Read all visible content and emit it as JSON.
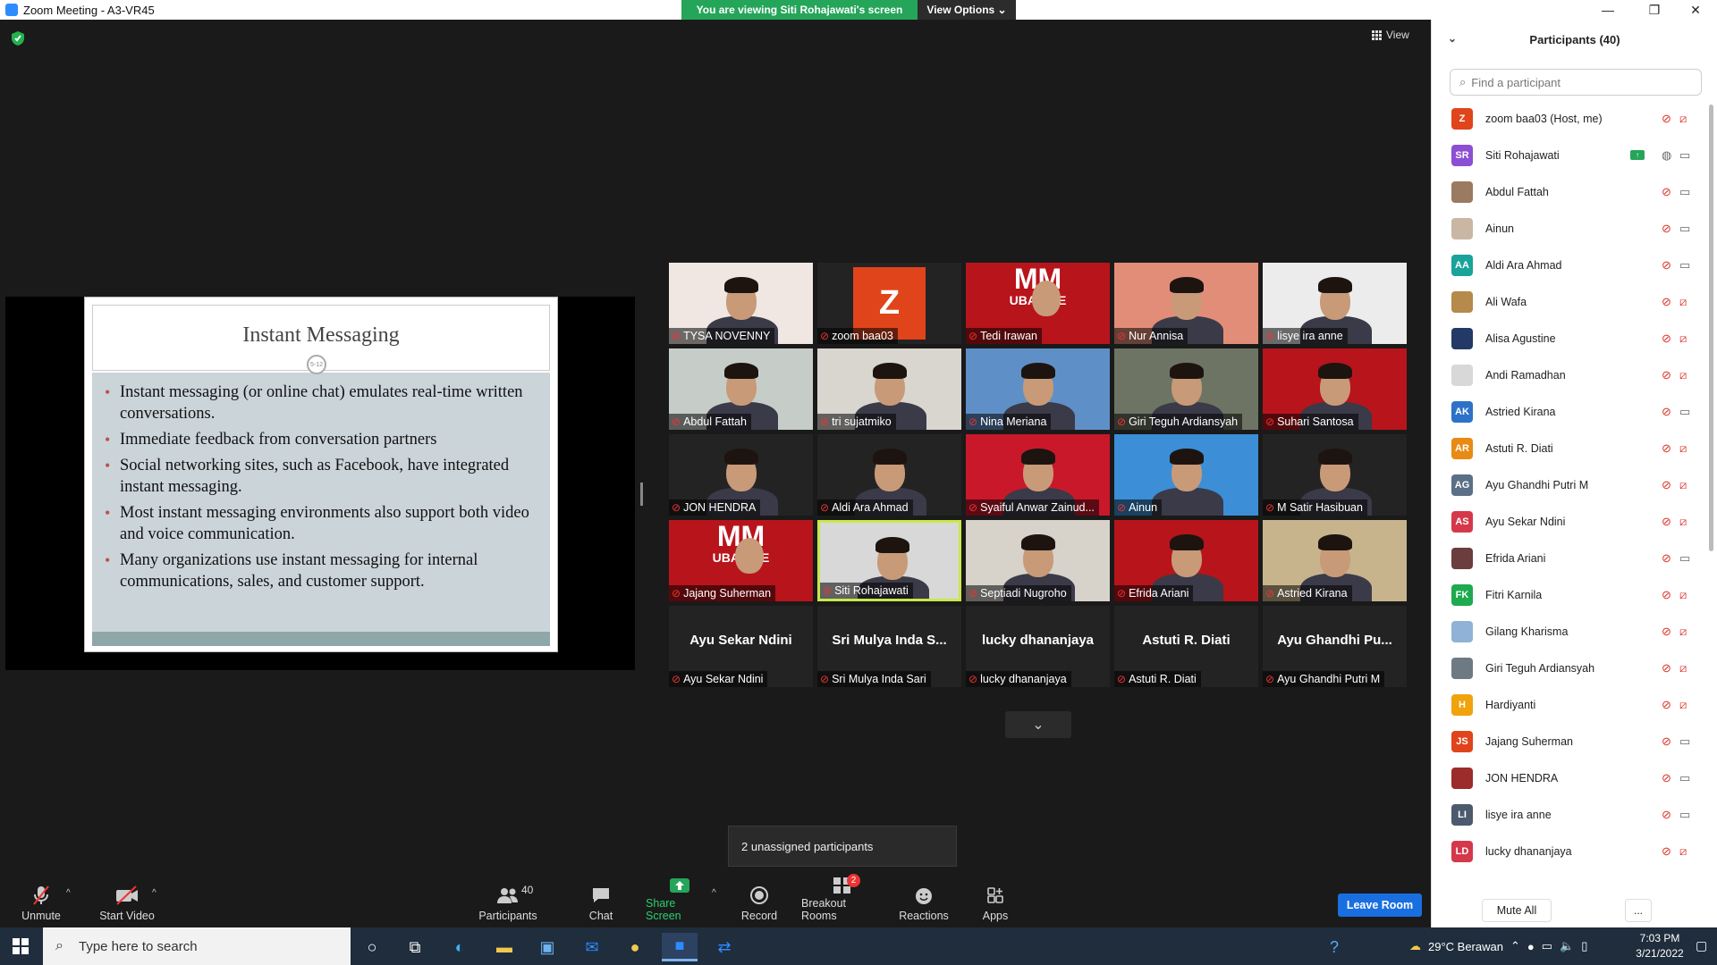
{
  "window": {
    "title": "Zoom Meeting - A3-VR45",
    "controls": [
      "—",
      "❐",
      "✕"
    ]
  },
  "share_banner": {
    "text": "You are viewing Siti Rohajawati's screen",
    "options_label": "View Options ⌄"
  },
  "view_button": {
    "label": "View"
  },
  "slide": {
    "title": "Instant Messaging",
    "number": "5-12",
    "bullets": [
      "Instant messaging (or online chat) emulates real-time written conversations.",
      "Immediate feedback from conversation partners",
      "Social networking sites, such as Facebook,  have integrated instant messaging.",
      "Most instant messaging environments also support both video and voice communication.",
      "Many organizations use instant messaging for internal communications, sales, and customer support."
    ]
  },
  "video_tiles": [
    {
      "name": "TYSA NOVENNY",
      "bg": "#f0e6e2"
    },
    {
      "name": "zoom baa03",
      "bg": "#232323",
      "avatar": "Z"
    },
    {
      "name": "Tedi Irawan",
      "bg": "#b8141c",
      "overlay": "MM"
    },
    {
      "name": "Nur Annisa",
      "bg": "#e28d78"
    },
    {
      "name": "lisye ira anne",
      "bg": "#ececec"
    },
    {
      "name": "Abdul Fattah",
      "bg": "#c6cdc8"
    },
    {
      "name": "tri sujatmiko",
      "bg": "#d9d6d0"
    },
    {
      "name": "Nina Meriana",
      "bg": "#5f8fc7"
    },
    {
      "name": "Giri Teguh Ardiansyah",
      "bg": "#6d7463"
    },
    {
      "name": "Suhari Santosa",
      "bg": "#b8141c"
    },
    {
      "name": "JON HENDRA",
      "bg": "#232323"
    },
    {
      "name": "Aldi Ara Ahmad",
      "bg": "#232323"
    },
    {
      "name": "Syaiful Anwar Zainud...",
      "bg": "#c9182a"
    },
    {
      "name": "Ainun",
      "bg": "#3c8ed6"
    },
    {
      "name": "M Satir Hasibuan",
      "bg": "#232323"
    },
    {
      "name": "Jajang Suherman",
      "bg": "#b8141c",
      "overlay": "MM"
    },
    {
      "name": "Siti Rohajawati",
      "bg": "#d8d8d8",
      "active": true
    },
    {
      "name": "Septiadi Nugroho",
      "bg": "#d7d2ca"
    },
    {
      "name": "Efrida Ariani",
      "bg": "#b8141c"
    },
    {
      "name": "Astried Kirana",
      "bg": "#c7b48d"
    },
    {
      "name": "Ayu Sekar Ndini",
      "bg": "#232323",
      "big": "Ayu Sekar Ndini"
    },
    {
      "name": "Sri Mulya Inda Sari",
      "bg": "#232323",
      "big": "Sri Mulya Inda S..."
    },
    {
      "name": "lucky dhananjaya",
      "bg": "#232323",
      "big": "lucky dhananjaya"
    },
    {
      "name": "Astuti R. Diati",
      "bg": "#232323",
      "big": "Astuti R. Diati"
    },
    {
      "name": "Ayu Ghandhi Putri M",
      "bg": "#232323",
      "big": "Ayu Ghandhi Pu..."
    }
  ],
  "tile_overlay_sub": "UBAKRIE",
  "unassigned": "2 unassigned participants",
  "toolbar": {
    "unmute": "Unmute",
    "start_video": "Start Video",
    "participants": "Participants",
    "participants_count": "40",
    "chat": "Chat",
    "share_screen": "Share Screen",
    "record": "Record",
    "breakout_rooms": "Breakout Rooms",
    "breakout_badge": "2",
    "reactions": "Reactions",
    "apps": "Apps",
    "leave_room": "Leave Room"
  },
  "panel": {
    "title": "Participants (40)",
    "search_placeholder": "Find a participant",
    "mute_all": "Mute All",
    "more": "...",
    "participants": [
      {
        "name": "zoom baa03 (Host, me)",
        "initials": "Z",
        "color": "#e0441b",
        "cam_on": false
      },
      {
        "name": "Siti Rohajawati",
        "initials": "SR",
        "color": "#8c4fd3",
        "cam_on": true,
        "sharing": true
      },
      {
        "name": "Abdul Fattah",
        "initials": "",
        "color": "#9b7a62",
        "cam_on": true
      },
      {
        "name": "Ainun",
        "initials": "",
        "color": "#c9b7a3",
        "cam_on": true
      },
      {
        "name": "Aldi Ara Ahmad",
        "initials": "AA",
        "color": "#1aa39a",
        "cam_on": true
      },
      {
        "name": "Ali Wafa",
        "initials": "",
        "color": "#b58a4a",
        "cam_on": false
      },
      {
        "name": "Alisa Agustine",
        "initials": "",
        "color": "#233a66",
        "cam_on": false
      },
      {
        "name": "Andi Ramadhan",
        "initials": "",
        "color": "#d8d8d8",
        "cam_on": false
      },
      {
        "name": "Astried Kirana",
        "initials": "AK",
        "color": "#2d72c8",
        "cam_on": true
      },
      {
        "name": "Astuti R. Diati",
        "initials": "AR",
        "color": "#e88a13",
        "cam_on": false
      },
      {
        "name": "Ayu Ghandhi Putri M",
        "initials": "AG",
        "color": "#5b6f86",
        "cam_on": false
      },
      {
        "name": "Ayu Sekar Ndini",
        "initials": "AS",
        "color": "#d5384a",
        "cam_on": false
      },
      {
        "name": "Efrida Ariani",
        "initials": "",
        "color": "#6b3d3d",
        "cam_on": true
      },
      {
        "name": "Fitri Karnila",
        "initials": "FK",
        "color": "#1eaa4e",
        "cam_on": false
      },
      {
        "name": "Gilang Kharisma",
        "initials": "",
        "color": "#8fb2d6",
        "cam_on": false
      },
      {
        "name": "Giri Teguh Ardiansyah",
        "initials": "",
        "color": "#6e7a83",
        "cam_on": false
      },
      {
        "name": "Hardiyanti",
        "initials": "H",
        "color": "#f0a30c",
        "cam_on": false
      },
      {
        "name": "Jajang Suherman",
        "initials": "JS",
        "color": "#e0441b",
        "cam_on": true
      },
      {
        "name": "JON HENDRA",
        "initials": "",
        "color": "#9c2b2b",
        "cam_on": true
      },
      {
        "name": "lisye ira anne",
        "initials": "LI",
        "color": "#4c5a6e",
        "cam_on": true
      },
      {
        "name": "lucky dhananjaya",
        "initials": "LD",
        "color": "#d5384a",
        "cam_on": false
      }
    ]
  },
  "taskbar": {
    "search_placeholder": "Type here to search",
    "weather": "29°C  Berawan",
    "time": "7:03 PM",
    "date": "3/21/2022"
  }
}
